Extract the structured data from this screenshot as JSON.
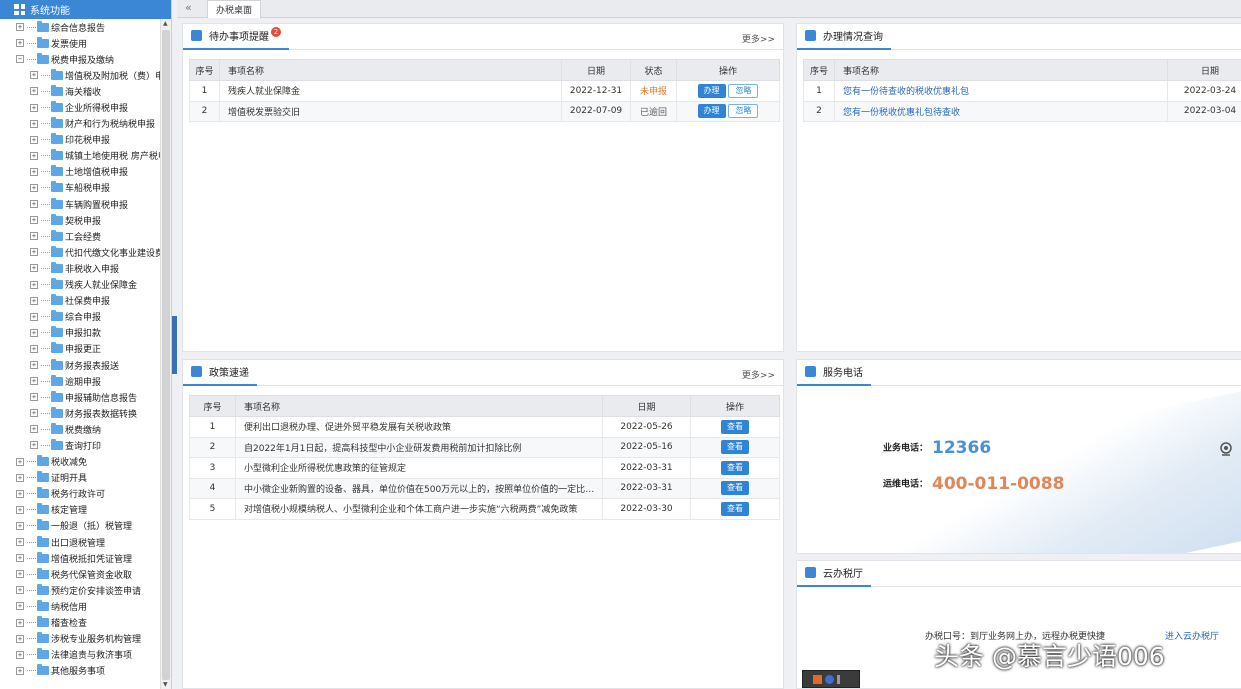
{
  "sidebar": {
    "title": "系统功能",
    "items": [
      {
        "label": "综合信息报告",
        "level": 0,
        "expanded": false
      },
      {
        "label": "发票使用",
        "level": 0,
        "expanded": false
      },
      {
        "label": "税费申报及缴纳",
        "level": 0,
        "expanded": true
      },
      {
        "label": "增值税及附加税（费）申报",
        "level": 1
      },
      {
        "label": "海关稽收",
        "level": 1
      },
      {
        "label": "企业所得税申报",
        "level": 1
      },
      {
        "label": "财产和行为税纳税申报",
        "level": 1
      },
      {
        "label": "印花税申报",
        "level": 1
      },
      {
        "label": "城镇土地使用税 房产税申报",
        "level": 1
      },
      {
        "label": "土地增值税申报",
        "level": 1
      },
      {
        "label": "车船税申报",
        "level": 1
      },
      {
        "label": "车辆购置税申报",
        "level": 1
      },
      {
        "label": "契税申报",
        "level": 1
      },
      {
        "label": "工会经费",
        "level": 1
      },
      {
        "label": "代扣代缴文化事业建设费",
        "level": 1
      },
      {
        "label": "非税收入申报",
        "level": 1
      },
      {
        "label": "残疾人就业保障金",
        "level": 1
      },
      {
        "label": "社保费申报",
        "level": 1
      },
      {
        "label": "综合申报",
        "level": 1
      },
      {
        "label": "申报扣款",
        "level": 1
      },
      {
        "label": "申报更正",
        "level": 1
      },
      {
        "label": "财务报表报送",
        "level": 1
      },
      {
        "label": "逾期申报",
        "level": 1
      },
      {
        "label": "申报辅助信息报告",
        "level": 1
      },
      {
        "label": "财务报表数据转换",
        "level": 1
      },
      {
        "label": "税费缴纳",
        "level": 1
      },
      {
        "label": "查询打印",
        "level": 1
      },
      {
        "label": "税收减免",
        "level": 0,
        "expanded": false
      },
      {
        "label": "证明开具",
        "level": 0,
        "expanded": false
      },
      {
        "label": "税务行政许可",
        "level": 0,
        "expanded": false
      },
      {
        "label": "核定管理",
        "level": 0,
        "expanded": false
      },
      {
        "label": "一般退（抵）税管理",
        "level": 0,
        "expanded": false
      },
      {
        "label": "出口退税管理",
        "level": 0,
        "expanded": false
      },
      {
        "label": "增值税抵扣凭证管理",
        "level": 0,
        "expanded": false
      },
      {
        "label": "税务代保管资金收取",
        "level": 0,
        "expanded": false
      },
      {
        "label": "预约定价安排谈签申请",
        "level": 0,
        "expanded": false
      },
      {
        "label": "纳税信用",
        "level": 0,
        "expanded": false
      },
      {
        "label": "稽查检查",
        "level": 0,
        "expanded": false
      },
      {
        "label": "涉税专业服务机构管理",
        "level": 0,
        "expanded": false
      },
      {
        "label": "法律追责与救济事项",
        "level": 0,
        "expanded": false
      },
      {
        "label": "其他服务事项",
        "level": 0,
        "expanded": false
      }
    ]
  },
  "tabs": {
    "back_glyph": "«",
    "active": "办税桌面"
  },
  "todo": {
    "title": "待办事项提醒",
    "badge": "2",
    "more": "更多>>",
    "headers": [
      "序号",
      "事项名称",
      "日期",
      "状态",
      "操作"
    ],
    "rows": [
      {
        "no": "1",
        "name": "残疾人就业保障金",
        "date": "2022-12-31",
        "status": "未申报",
        "status_color": "#e07a2c",
        "action1": "办理",
        "action2": "忽略"
      },
      {
        "no": "2",
        "name": "增值税发票验交旧",
        "date": "2022-07-09",
        "status": "已逾回",
        "status_color": "#555555",
        "action1": "办理",
        "action2": "忽略"
      }
    ]
  },
  "query": {
    "title": "办理情况查询",
    "headers": [
      "序号",
      "事项名称",
      "日期"
    ],
    "rows": [
      {
        "no": "1",
        "name": "您有一份待查收的税收优惠礼包",
        "date": "2022-03-24"
      },
      {
        "no": "2",
        "name": "您有一份税收优惠礼包待查收",
        "date": "2022-03-04"
      }
    ]
  },
  "policy": {
    "title": "政策速递",
    "more": "更多>>",
    "headers": [
      "序号",
      "事项名称",
      "日期",
      "操作"
    ],
    "rows": [
      {
        "no": "1",
        "name": "便利出口退税办理、促进外贸平稳发展有关税收政策",
        "date": "2022-05-26",
        "action": "查看"
      },
      {
        "no": "2",
        "name": "自2022年1月1日起，提高科技型中小企业研发费用税前加计扣除比例",
        "date": "2022-05-16",
        "action": "查看"
      },
      {
        "no": "3",
        "name": "小型微利企业所得税优惠政策的征管规定",
        "date": "2022-03-31",
        "action": "查看"
      },
      {
        "no": "4",
        "name": "中小微企业新购置的设备、器具，单位价值在500万元以上的，按照单位价值的一定比例...",
        "date": "2022-03-31",
        "action": "查看"
      },
      {
        "no": "5",
        "name": "对增值税小规模纳税人、小型微利企业和个体工商户进一步实施“六税两费”减免政策",
        "date": "2022-03-30",
        "action": "查看"
      }
    ]
  },
  "service": {
    "title": "服务电话",
    "business_label": "业务电话：",
    "business_number": "12366",
    "business_color": "#4a90d9",
    "ops_label": "运维电话：",
    "ops_number": "400-011-0088",
    "ops_color": "#e0865a"
  },
  "cloud": {
    "title": "云办税厅",
    "text": "办税口号：到厅业务网上办，远程办税更快捷",
    "enter": "进入云办税厅"
  },
  "watermark": "头条 @慕言少语006",
  "colors": {
    "primary": "#3b87d6",
    "badge": "#e24c3c"
  }
}
